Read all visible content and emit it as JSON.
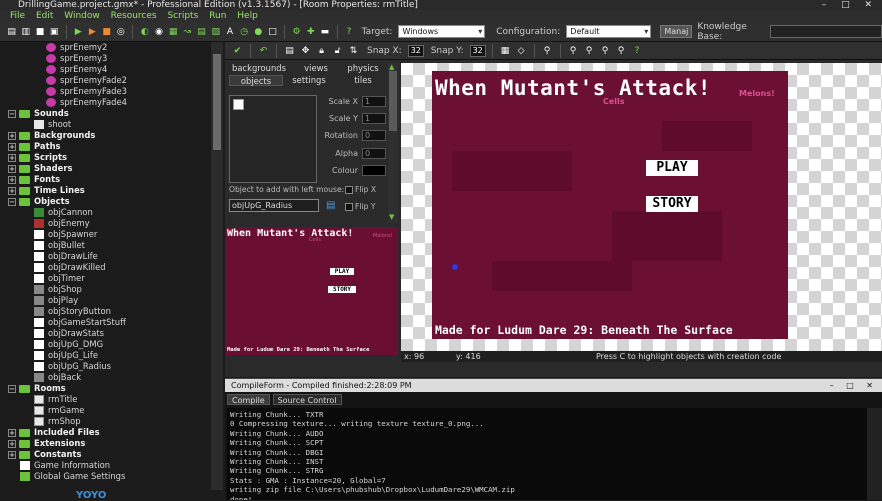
{
  "window": {
    "title": "DrillingGame.project.gmx* - Professional Edition (v1.3.1567) - [Room Properties: rmTitle]",
    "controls": [
      "–",
      "□",
      "✕"
    ]
  },
  "menu": [
    "File",
    "Edit",
    "Window",
    "Resources",
    "Scripts",
    "Run",
    "Help"
  ],
  "toolbar": {
    "target_label": "Target:",
    "target_value": "Windows",
    "configuration_label": "Configuration:",
    "configuration_value": "Default",
    "manage_label": "Manaj",
    "knowledge_base_label": "Knowledge Base:"
  },
  "tree": {
    "items": [
      {
        "label": "sprEnemy2",
        "kind": "sprite",
        "color": "#c83aa8",
        "indent": 46
      },
      {
        "label": "sprEnemy3",
        "kind": "sprite",
        "color": "#c83aa8",
        "indent": 46
      },
      {
        "label": "sprEnemy4",
        "kind": "sprite",
        "color": "#c83aa8",
        "indent": 46
      },
      {
        "label": "sprEnemyFade2",
        "kind": "sprite",
        "color": "#c83aa8",
        "indent": 46
      },
      {
        "label": "sprEnemyFade3",
        "kind": "sprite",
        "color": "#c83aa8",
        "indent": 46
      },
      {
        "label": "sprEnemyFade4",
        "kind": "sprite",
        "color": "#c83aa8",
        "indent": 46
      },
      {
        "label": "Sounds",
        "kind": "folder-open",
        "indent": 8
      },
      {
        "label": "shoot",
        "kind": "sound",
        "indent": 34
      },
      {
        "label": "Backgrounds",
        "kind": "folder",
        "indent": 8
      },
      {
        "label": "Paths",
        "kind": "folder",
        "indent": 8
      },
      {
        "label": "Scripts",
        "kind": "folder",
        "indent": 8
      },
      {
        "label": "Shaders",
        "kind": "folder",
        "indent": 8
      },
      {
        "label": "Fonts",
        "kind": "folder",
        "indent": 8
      },
      {
        "label": "Time Lines",
        "kind": "folder",
        "indent": 8
      },
      {
        "label": "Objects",
        "kind": "folder-open",
        "indent": 8
      },
      {
        "label": "objCannon",
        "kind": "object",
        "color": "#3a8a3a",
        "indent": 34
      },
      {
        "label": "objEnemy",
        "kind": "object",
        "color": "#b03030",
        "indent": 34
      },
      {
        "label": "objSpawner",
        "kind": "object",
        "color": "#ffffff",
        "indent": 34
      },
      {
        "label": "objBullet",
        "kind": "object",
        "color": "#ffffff",
        "indent": 34
      },
      {
        "label": "objDrawLife",
        "kind": "object",
        "color": "#ffffff",
        "indent": 34
      },
      {
        "label": "objDrawKilled",
        "kind": "object",
        "color": "#ffffff",
        "indent": 34
      },
      {
        "label": "objTimer",
        "kind": "object",
        "color": "#ffffff",
        "indent": 34
      },
      {
        "label": "objShop",
        "kind": "object",
        "color": "#888888",
        "indent": 34
      },
      {
        "label": "objPlay",
        "kind": "object",
        "color": "#888888",
        "indent": 34
      },
      {
        "label": "objStoryButton",
        "kind": "object",
        "color": "#888888",
        "indent": 34
      },
      {
        "label": "objGameStartStuff",
        "kind": "object",
        "color": "#ffffff",
        "indent": 34
      },
      {
        "label": "objDrawStats",
        "kind": "object",
        "color": "#ffffff",
        "indent": 34
      },
      {
        "label": "objUpG_DMG",
        "kind": "object",
        "color": "#ffffff",
        "indent": 34
      },
      {
        "label": "objUpG_Life",
        "kind": "object",
        "color": "#ffffff",
        "indent": 34
      },
      {
        "label": "objUpG_Radius",
        "kind": "object",
        "color": "#ffffff",
        "indent": 34
      },
      {
        "label": "objBack",
        "kind": "object",
        "color": "#888888",
        "indent": 34
      },
      {
        "label": "Rooms",
        "kind": "folder-open",
        "indent": 8
      },
      {
        "label": "rmTitle",
        "kind": "room",
        "indent": 34
      },
      {
        "label": "rmGame",
        "kind": "room",
        "indent": 34
      },
      {
        "label": "rmShop",
        "kind": "room",
        "indent": 34
      },
      {
        "label": "Included Files",
        "kind": "folder",
        "indent": 8
      },
      {
        "label": "Extensions",
        "kind": "folder",
        "indent": 8
      },
      {
        "label": "Constants",
        "kind": "folder",
        "indent": 8
      },
      {
        "label": "Game Information",
        "kind": "info",
        "indent": 20
      },
      {
        "label": "Global Game Settings",
        "kind": "settings",
        "indent": 20
      }
    ],
    "brand": "YOYO"
  },
  "room_toolbar": {
    "snap_x_label": "Snap X:",
    "snap_x": "32",
    "snap_y_label": "Snap Y:",
    "snap_y": "32"
  },
  "room_tabs": {
    "row1": [
      "backgrounds",
      "views",
      "physics"
    ],
    "row2": [
      "objects",
      "settings",
      "tiles"
    ],
    "active": "objects"
  },
  "object_panel": {
    "scale_x_label": "Scale X",
    "scale_x": "1",
    "scale_y_label": "Scale Y",
    "scale_y": "1",
    "rotation_label": "Rotation",
    "rotation": "0",
    "alpha_label": "Alpha",
    "alpha": "0",
    "colour_label": "Colour",
    "add_label": "Object to add with left mouse:",
    "selected_object": "objUpG_Radius",
    "flip_x_label": "Flip X",
    "flip_y_label": "Flip Y"
  },
  "room_view": {
    "title": "When Mutant's Attack!",
    "cells_label": "Cells",
    "melons_label": "Melons!",
    "play_button": "PLAY",
    "story_button": "STORY",
    "footer": "Made for Ludum Dare 29: Beneath The Surface",
    "bg_color": "#6b0f33"
  },
  "status": {
    "x": "x: 96",
    "y": "y: 416",
    "hint": "Press C to highlight objects with creation code"
  },
  "compile": {
    "title": "CompileForm - Compiled finished:2:28:09 PM",
    "tabs": [
      "Compile",
      "Source Control"
    ],
    "active_tab": "Compile",
    "log": [
      "Writing Chunk... TXTR",
      "0 Compressing texture... writing texture texture_0.png...",
      "Writing Chunk... AUDO",
      "Writing Chunk... SCPT",
      "Writing Chunk... DBGI",
      "Writing Chunk... INST",
      "Writing Chunk... STRG",
      "Stats : GMA : Instance=20, Global=7",
      "writing zip file C:\\Users\\phubshub\\Dropbox\\LudumDare29\\WMCAM.zip",
      "done!"
    ]
  }
}
